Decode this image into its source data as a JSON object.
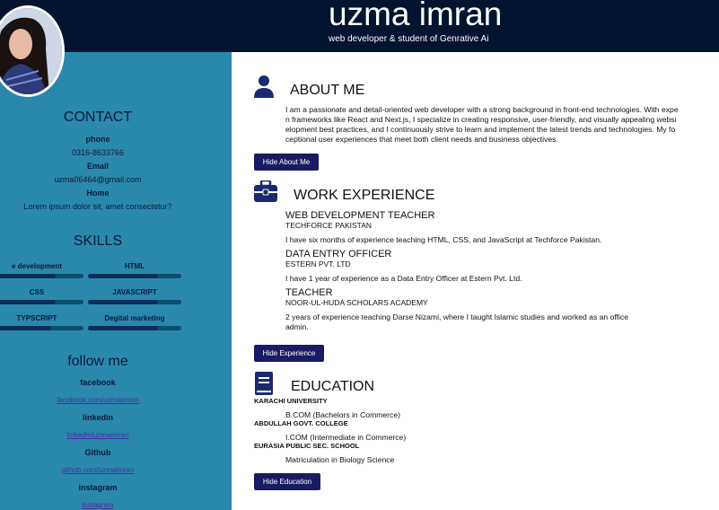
{
  "header": {
    "name": "uzma imran",
    "tagline": "web developer & student of Genrative Ai"
  },
  "sidebar": {
    "contact_title": "CONTACT",
    "phone_label": "phone",
    "phone_value": "0316-8633766",
    "email_label": "Email",
    "email_value": "uzma06464@gmail.com",
    "home_label": "Home",
    "home_value": "Lorem ipsum dolor sit, amet consectetur?",
    "skills_title": "SKILLS",
    "skills": [
      {
        "label": "e development",
        "level": 0.7
      },
      {
        "label": "HTML",
        "level": 0.75
      },
      {
        "label": "CSS",
        "level": 0.7
      },
      {
        "label": "JAVASCRIPT",
        "level": 0.75
      },
      {
        "label": "TYPSCRIPT",
        "level": 0.65
      },
      {
        "label": "Degital marketing",
        "level": 0.75
      }
    ],
    "follow_title": "follow me",
    "facebook_label": "facebook",
    "facebook_link": "facebook.com/uzmaimran",
    "linkedin_label": "linkedin",
    "linkedin_link": "linkedin/uzmaimran",
    "github_label": "Github",
    "github_link": "github.com/uzmaimran",
    "instagram_label": "instagram",
    "instagram_link": "instagram"
  },
  "about": {
    "title": "ABOUT ME",
    "lines": [
      "I am a passionate and detail-oriented web developer with a strong background in front-end technologies. With expe",
      "n frameworks like React and Next.js, I specialize in creating responsive, user-friendly, and visually appealing websi",
      "elopment best practices, and I continuously strive to learn and implement the latest trends and technologies. My fo",
      "ceptional user experiences that meet both client needs and business objectives."
    ],
    "button": "Hide About Me"
  },
  "experience": {
    "title": "WORK EXPERIENCE",
    "jobs": [
      {
        "title": "WEB DEVELOPMENT TEACHER",
        "org": "TECHFORCE PAKISTAN",
        "desc": "I have six months of experience teaching HTML, CSS, and JavaScript at Techforce Pakistan."
      },
      {
        "title": "DATA ENTRY OFFICER",
        "org": "ESTERN PVT. LTD",
        "desc": "I have 1 year of experience as a Data Entry Officer at Estern Pvt. Ltd."
      },
      {
        "title": "TEACHER",
        "org": "NOOR-UL-HUDA SCHOLARS ACADEMY",
        "desc": "2 years of experience teaching Darse Nizami, where I taught Islamic studies and worked as an office admin."
      }
    ],
    "button": "Hide Experience"
  },
  "education": {
    "title": "EDUCATION",
    "items": [
      {
        "school": "KARACHI UNIVERSITY",
        "degree": "B.COM (Bachelors in Commerce)"
      },
      {
        "school": "ABDULLAH GOVT. COLLEGE",
        "degree": "I.COM (Intermediate in Commerce)"
      },
      {
        "school": "EURASIA PUBLIC SEC. SCHOOL",
        "degree": "Matriculation in Biology Science"
      }
    ],
    "button": "Hide Education"
  },
  "colors": {
    "header_bg": "#02142f",
    "sidebar_bg": "#2a88ad",
    "button_bg": "#1b1b63",
    "icon": "#1a2a6c"
  },
  "icons": {
    "about": "user-icon",
    "experience": "briefcase-icon",
    "education": "book-icon"
  }
}
